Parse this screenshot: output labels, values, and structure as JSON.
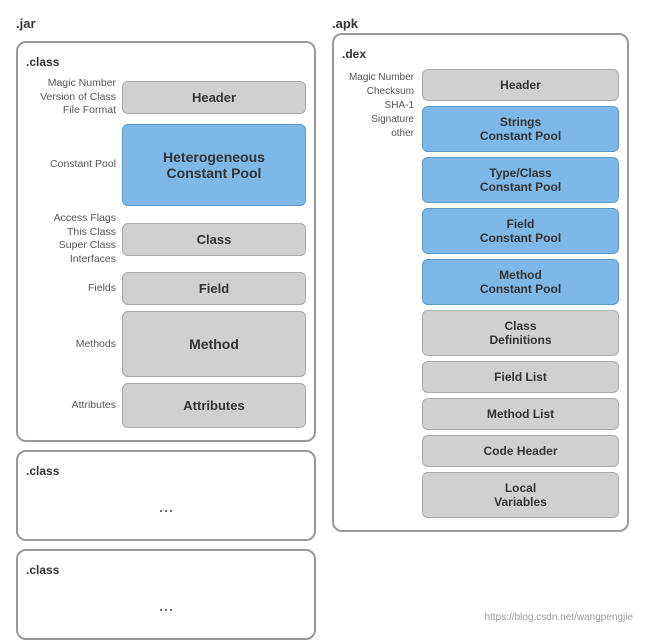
{
  "jar": {
    "label": ".jar",
    "classBox1": {
      "label": ".class",
      "rows": [
        {
          "label": "Magic Number\nVersion of Class File Format",
          "block": "Header",
          "style": "gray"
        },
        {
          "label": "Constant Pool",
          "block": "Heterogeneous\nConstant Pool",
          "style": "blue",
          "size": "large"
        },
        {
          "label": "Access Flags\nThis Class\nSuper Class\nInterfaces",
          "block": "Class",
          "style": "gray"
        },
        {
          "label": "Fields",
          "block": "Field",
          "style": "gray"
        },
        {
          "label": "Methods",
          "block": "Method",
          "style": "gray",
          "size": "large"
        },
        {
          "label": "Attributes",
          "block": "Attributes",
          "style": "gray",
          "size": "medium"
        }
      ]
    },
    "classBox2": {
      "label": ".class",
      "dots": "..."
    },
    "classBox3": {
      "label": ".class",
      "dots": "..."
    }
  },
  "apk": {
    "label": ".apk",
    "dexBox": {
      "label": ".dex",
      "headerLabel": "Magic Number\nChecksum\nSHA-1 Signature\nother",
      "headerBlock": "Header",
      "blocks": [
        {
          "text": "Strings\nConstant Pool",
          "style": "blue"
        },
        {
          "text": "Type/Class\nConstant Pool",
          "style": "blue"
        },
        {
          "text": "Field\nConstant Pool",
          "style": "blue"
        },
        {
          "text": "Method\nConstant Pool",
          "style": "blue"
        },
        {
          "text": "Class\nDefinitions",
          "style": "gray"
        },
        {
          "text": "Field List",
          "style": "gray"
        },
        {
          "text": "Method List",
          "style": "gray"
        },
        {
          "text": "Code Header",
          "style": "gray"
        },
        {
          "text": "Local\nVariables",
          "style": "gray"
        }
      ]
    }
  },
  "watermark": "https://blog.csdn.net/wangpengjie"
}
